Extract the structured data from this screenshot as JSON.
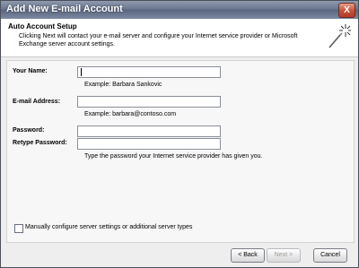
{
  "window": {
    "title": "Add New E-mail Account",
    "close_glyph": "X"
  },
  "header": {
    "title": "Auto Account Setup",
    "description": "Clicking Next will contact your e-mail server and configure your Internet service provider or Microsoft Exchange server account settings."
  },
  "form": {
    "name_label": "Your Name:",
    "name_value": "",
    "name_example": "Example: Barbara Sankovic",
    "email_label": "E-mail Address:",
    "email_value": "",
    "email_example": "Example: barbara@contoso.com",
    "password_label": "Password:",
    "retype_label": "Retype Password:",
    "password_hint": "Type the password your Internet service provider has given you."
  },
  "manual_config": {
    "label": "Manually configure server settings or additional server types",
    "checked": false
  },
  "buttons": {
    "back": "< Back",
    "next": "Next >",
    "cancel": "Cancel"
  }
}
